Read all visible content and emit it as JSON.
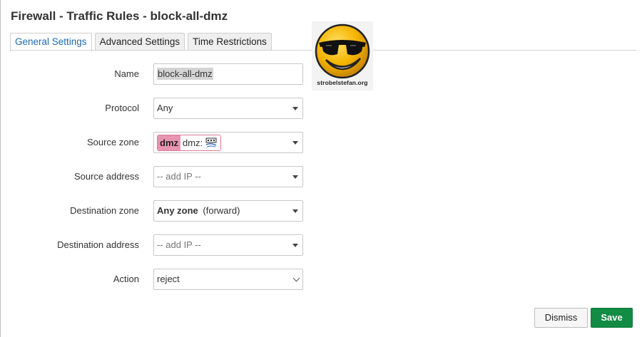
{
  "modal": {
    "title": "Firewall - Traffic Rules - block-all-dmz"
  },
  "tabs": [
    {
      "label": "General Settings",
      "active": true
    },
    {
      "label": "Advanced Settings",
      "active": false
    },
    {
      "label": "Time Restrictions",
      "active": false
    }
  ],
  "fields": {
    "name": {
      "label": "Name",
      "value": "block-all-dmz"
    },
    "protocol": {
      "label": "Protocol",
      "value": "Any"
    },
    "source_zone": {
      "label": "Source zone",
      "zone": "dmz",
      "networks": "dmz:",
      "badge_color": "#e795b0"
    },
    "source_address": {
      "label": "Source address",
      "placeholder": "-- add IP --"
    },
    "destination_zone": {
      "label": "Destination zone",
      "zone": "Any zone",
      "suffix": "(forward)"
    },
    "destination_address": {
      "label": "Destination address",
      "placeholder": "-- add IP --"
    },
    "action": {
      "label": "Action",
      "value": "reject"
    }
  },
  "logo": {
    "caption": "strobelstefan.org"
  },
  "buttons": {
    "dismiss": "Dismiss",
    "save": "Save"
  },
  "colors": {
    "accent": "#1c6ab1",
    "save": "#128b44"
  }
}
